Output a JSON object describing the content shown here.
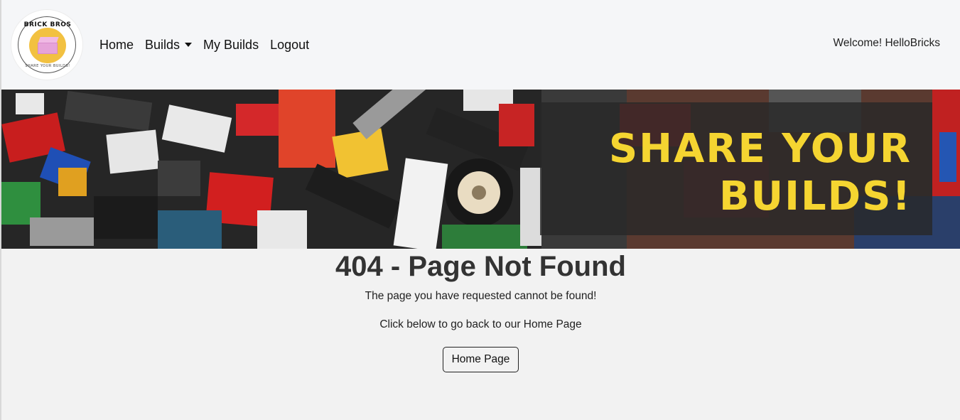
{
  "logo": {
    "text_top": "BRICK BROS",
    "text_bottom": "SHARE YOUR BUILDS!"
  },
  "nav": {
    "home": "Home",
    "builds": "Builds",
    "my_builds": "My Builds",
    "logout": "Logout"
  },
  "user": {
    "welcome": "Welcome! HelloBricks"
  },
  "hero": {
    "line1": "SHARE YOUR",
    "line2": "BUILDS!"
  },
  "error": {
    "title": "404 - Page Not Found",
    "message": "The page you have requested cannot be found!",
    "sub": "Click below to go back to our Home Page",
    "button": "Home Page"
  },
  "colors": {
    "hero_text": "#f5d531",
    "navbar_bg": "#f5f6f8",
    "page_bg": "#f2f2f2"
  }
}
